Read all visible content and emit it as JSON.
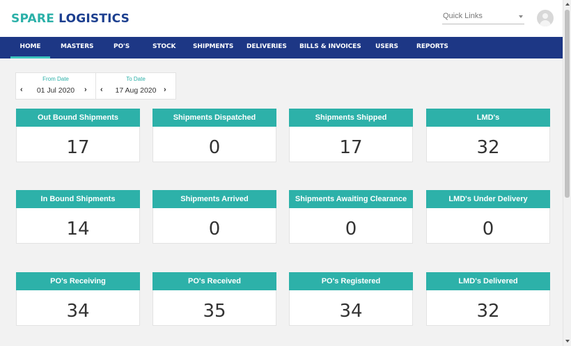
{
  "brand": {
    "part1": "SPARE",
    "part2": "LOGISTICS"
  },
  "quick_links": {
    "label": "Quick Links"
  },
  "nav": [
    {
      "label": "HOME",
      "active": true
    },
    {
      "label": "MASTERS"
    },
    {
      "label": "PO'S"
    },
    {
      "label": "STOCK"
    },
    {
      "label": "SHIPMENTS"
    },
    {
      "label": "DELIVERIES"
    },
    {
      "label": "BILLS & INVOICES"
    },
    {
      "label": "USERS"
    },
    {
      "label": "REPORTS"
    }
  ],
  "filters": {
    "from": {
      "label": "From Date",
      "value": "01 Jul 2020"
    },
    "to": {
      "label": "To Date",
      "value": "17 Aug 2020"
    }
  },
  "cards": [
    {
      "title": "Out Bound Shipments",
      "value": "17"
    },
    {
      "title": "Shipments Dispatched",
      "value": "0"
    },
    {
      "title": "Shipments Shipped",
      "value": "17"
    },
    {
      "title": "LMD's",
      "value": "32"
    },
    {
      "title": "In Bound Shipments",
      "value": "14"
    },
    {
      "title": "Shipments Arrived",
      "value": "0"
    },
    {
      "title": "Shipments Awaiting Clearance",
      "value": "0"
    },
    {
      "title": "LMD's Under Delivery",
      "value": "0"
    },
    {
      "title": "PO's Receiving",
      "value": "34"
    },
    {
      "title": "PO's Received",
      "value": "35"
    },
    {
      "title": "PO's Registered",
      "value": "34"
    },
    {
      "title": "LMD's Delivered",
      "value": "32"
    }
  ],
  "colors": {
    "accent": "#2db1a9",
    "nav": "#1d3785",
    "brand_dark": "#1c3f8f"
  },
  "icons": [
    "chevron-down-icon",
    "user-avatar-icon",
    "chevron-left-icon",
    "chevron-right-icon"
  ]
}
